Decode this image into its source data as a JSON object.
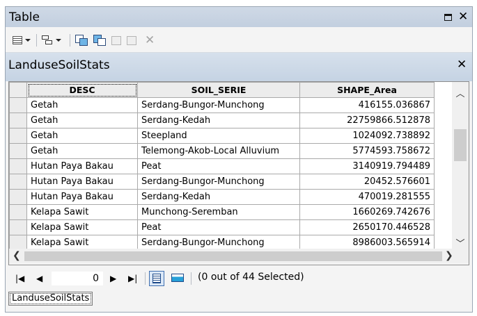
{
  "window": {
    "title": "Table"
  },
  "table_tab": {
    "title": "LanduseSoilStats"
  },
  "columns": [
    "DESC",
    "SOIL_SERIE",
    "SHAPE_Area"
  ],
  "rows": [
    [
      "Getah",
      "Serdang-Bungor-Munchong",
      "416155.036867"
    ],
    [
      "Getah",
      "Serdang-Kedah",
      "22759866.512878"
    ],
    [
      "Getah",
      "Steepland",
      "1024092.738892"
    ],
    [
      "Getah",
      "Telemong-Akob-Local Alluvium",
      "5774593.758672"
    ],
    [
      "Hutan Paya Bakau",
      "Peat",
      "3140919.794489"
    ],
    [
      "Hutan Paya Bakau",
      "Serdang-Bungor-Munchong",
      "20452.576601"
    ],
    [
      "Hutan Paya Bakau",
      "Serdang-Kedah",
      "470019.281555"
    ],
    [
      "Kelapa Sawit",
      "Munchong-Seremban",
      "1660269.742676"
    ],
    [
      "Kelapa Sawit",
      "Peat",
      "2650170.446528"
    ],
    [
      "Kelapa Sawit",
      "Serdang-Bungor-Munchong",
      "8986003.565914"
    ]
  ],
  "navigation": {
    "current_record": "0",
    "selection_text": "(0 out of 44 Selected)"
  },
  "bottom_tabs": [
    "LanduseSoilStats"
  ],
  "icons": {
    "restore": "restore-icon",
    "close": "close-icon",
    "first": "first-record-icon",
    "prev": "previous-record-icon",
    "next": "next-record-icon",
    "last": "last-record-icon"
  },
  "colors": {
    "header_band": "#c5d3e3",
    "title_band": "#c2cfdf",
    "grid_border": "#a9a9a9",
    "highlight": "#3f6fb0"
  }
}
